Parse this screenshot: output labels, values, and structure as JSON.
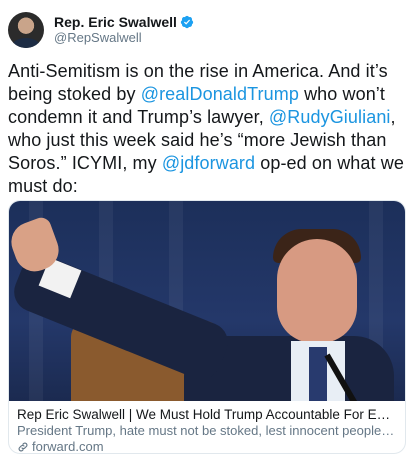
{
  "author": {
    "display_name": "Rep. Eric Swalwell",
    "handle": "@RepSwalwell",
    "verified_icon": "verified-badge-icon",
    "badge_color": "#1da1f2"
  },
  "tweet": {
    "seg1": "Anti-Semitism is on the rise in America. And it’s being stoked by ",
    "mention1": "@realDonaldTrump",
    "seg2": " who won’t condemn it and Trump’s lawyer, ",
    "mention2": "@RudyGiuliani",
    "seg3": ", who just this week said he’s “more Jewish than Soros.” ICYMI, my ",
    "mention3": "@jdforward",
    "seg4": " op-ed on what we must do:"
  },
  "card": {
    "title": "Rep Eric Swalwell | We Must Hold Trump Accountable For Embracing Anti...",
    "description": "President Trump, hate must not be stoked, lest innocent people die.",
    "domain": "forward.com",
    "link_icon": "link-icon"
  },
  "colors": {
    "mention": "#1b95e0",
    "secondary_text": "#657786"
  }
}
